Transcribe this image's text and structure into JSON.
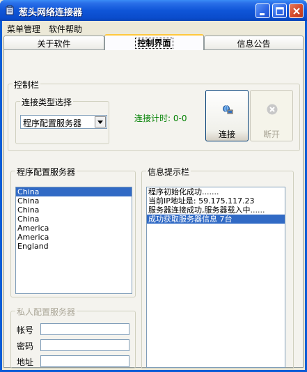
{
  "window": {
    "title": "葱头网络连接器",
    "icon": "app-icon",
    "minimize_icon": "minimize-icon",
    "maximize_icon": "maximize-icon",
    "close_icon": "close-icon"
  },
  "menu": {
    "items": [
      {
        "label": "菜单管理"
      },
      {
        "label": "软件帮助"
      }
    ]
  },
  "tabs": [
    {
      "label": "关于软件",
      "active": false
    },
    {
      "label": "控制界面",
      "active": true
    },
    {
      "label": "信息公告",
      "active": false
    }
  ],
  "control": {
    "group_label": "控制栏",
    "connection_type_label": "连接类型选择",
    "connection_type_value": "程序配置服务器",
    "timer_text": "连接计时: 0-0",
    "connect_label": "连接",
    "connect_icon": "network-connect-icon",
    "disconnect_label": "断开",
    "disconnect_icon": "disconnect-icon"
  },
  "servers": {
    "group_label": "程序配置服务器",
    "items": [
      "China",
      "China",
      "China",
      "China",
      "America",
      "America",
      "England"
    ],
    "selected_index": 0
  },
  "info": {
    "group_label": "信息提示栏",
    "lines": [
      "程序初始化成功.......",
      "当前IP地址是: 59.175.117.23",
      "服务器连接成功,服务器载入中......",
      "成功获取服务器信息 7台"
    ],
    "selected_index": 3
  },
  "private": {
    "group_label": "私人配置服务器",
    "account_label": "帐号",
    "password_label": "密码",
    "address_label": "地址"
  },
  "colors": {
    "titlebar": "#0A5CD6",
    "selection": "#316AC5",
    "timer": "#008000"
  }
}
